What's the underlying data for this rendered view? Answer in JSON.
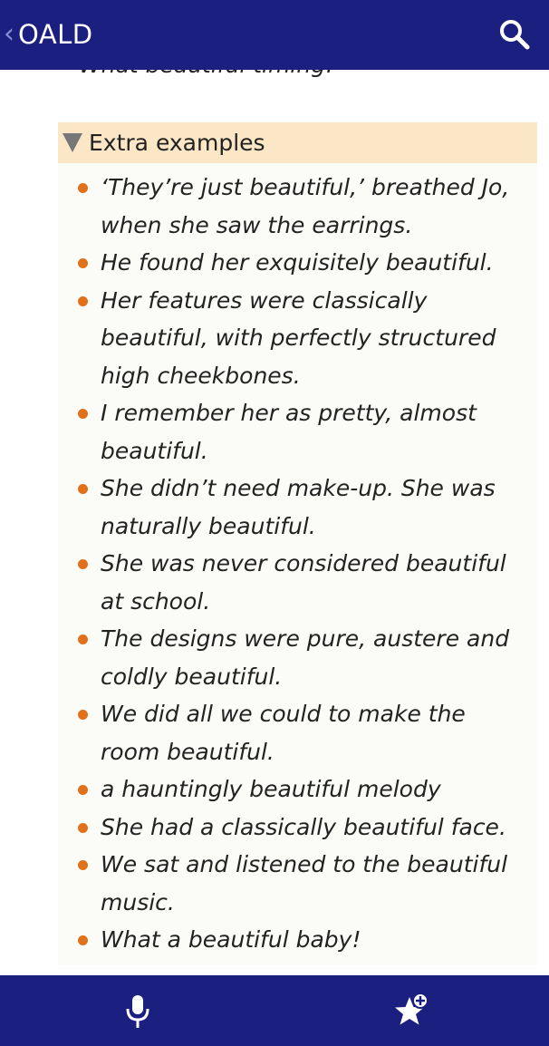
{
  "header": {
    "back_icon": "chevron-left-icon",
    "title": "OALD",
    "search_icon": "search-icon"
  },
  "content": {
    "previous_example": "What beautiful timing!",
    "extra_examples": {
      "label": "Extra examples",
      "toggle_icon": "triangle-down-icon",
      "items": [
        "‘They’re just beautiful,’ breathed Jo, when she saw the earrings.",
        "He found her exquisitely beautiful.",
        "Her features were classically beautiful, with perfectly structured high cheekbones.",
        "I remember her as pretty, almost beautiful.",
        "She didn’t need make-up. She was naturally beautiful.",
        "She was never considered beautiful at school.",
        "The designs were pure, austere and coldly beautiful.",
        "We did all we could to make the room beautiful.",
        "a hauntingly beautiful melody",
        "She had a classically beautiful face.",
        "We sat and listened to the beautiful music.",
        "What a beautiful baby!"
      ]
    }
  },
  "bottom_bar": {
    "mic_icon": "microphone-icon",
    "favorite_icon": "star-add-icon"
  },
  "colors": {
    "bar_background": "#1b1f80",
    "bullet": "#e0701a",
    "box_header": "#fbe7c6",
    "box_background": "#fbfbf8"
  }
}
